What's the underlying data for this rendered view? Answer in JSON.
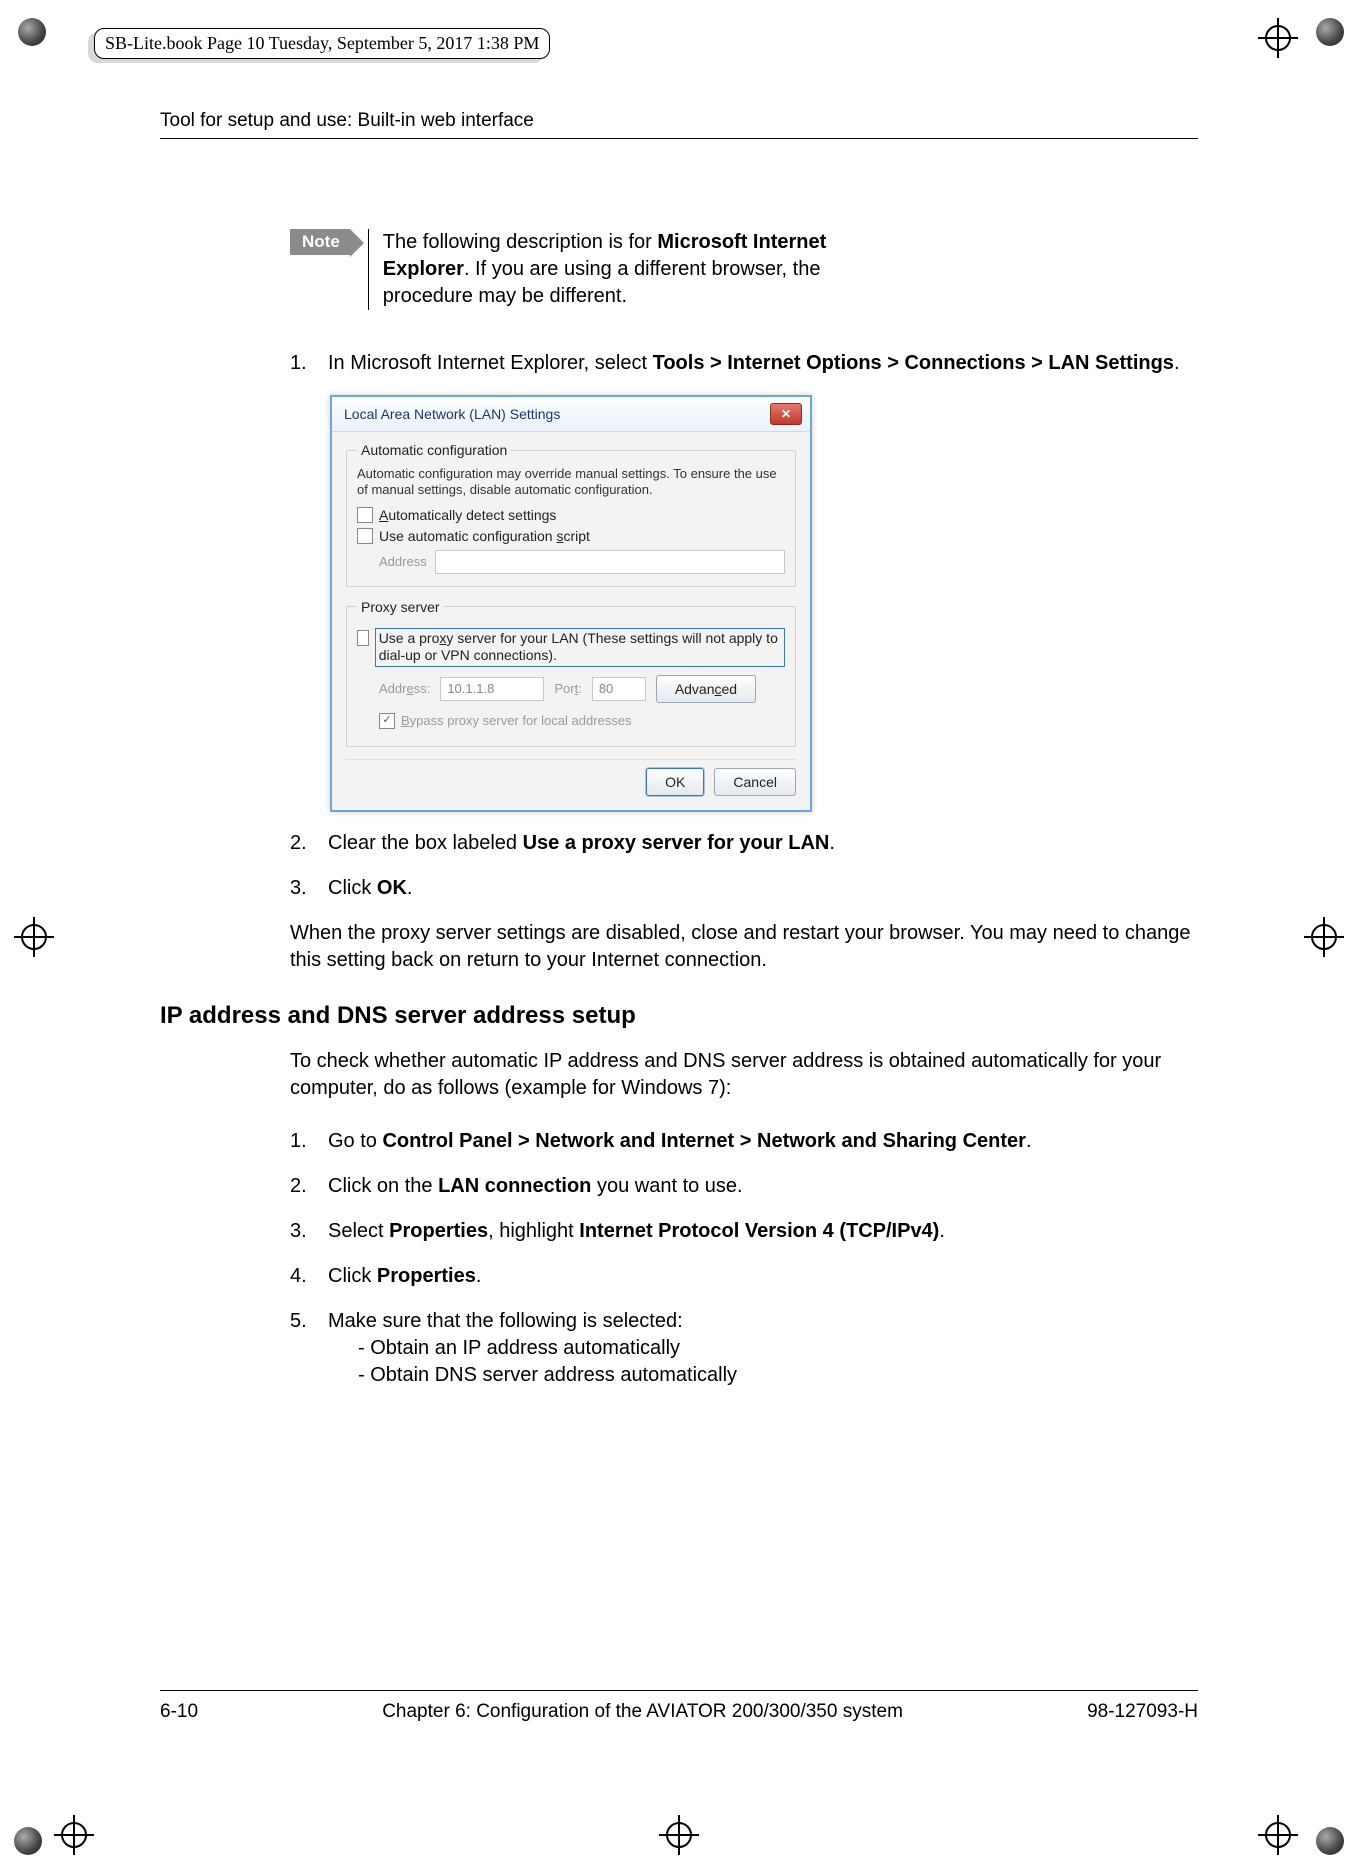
{
  "meta": {
    "print_note": "SB-Lite.book  Page 10  Tuesday, September 5, 2017  1:38 PM"
  },
  "header": {
    "running": "Tool for setup and use: Built-in web interface"
  },
  "note": {
    "badge": "Note",
    "text_prefix": "The following description is for ",
    "text_bold": "Microsoft Internet Explorer",
    "text_suffix": ". If you are using a different browser, the procedure may be different."
  },
  "stepsA": {
    "s1": {
      "num": "1.",
      "pre": "In Microsoft Internet Explorer, select ",
      "bold": "Tools > Internet Options > Connections > LAN Settings",
      "post": "."
    },
    "s2": {
      "num": "2.",
      "pre": "Clear the box labeled ",
      "bold": "Use a proxy server for your LAN",
      "post": "."
    },
    "s3": {
      "num": "3.",
      "pre": "Click ",
      "bold": "OK",
      "post": "."
    }
  },
  "paraA": "When the proxy server settings are disabled, close and restart your browser. You may need to change this setting back on return to your Internet connection.",
  "sectionB": {
    "title": "IP address and DNS server address setup",
    "intro": "To check whether automatic IP address and DNS server address is obtained automatically for your computer, do as follows (example for Windows 7):",
    "s1": {
      "num": "1.",
      "pre": "Go to ",
      "bold": "Control Panel > Network and Internet > Network and Sharing Center",
      "post": "."
    },
    "s2": {
      "num": "2.",
      "pre": "Click on the ",
      "bold": "LAN connection",
      "post": " you want to use."
    },
    "s3": {
      "num": "3.",
      "pre": "Select ",
      "bold1": "Properties",
      "mid": ", highlight ",
      "bold2": "Internet Protocol Version 4 (TCP/IPv4)",
      "post": "."
    },
    "s4": {
      "num": "4.",
      "pre": "Click ",
      "bold": "Properties",
      "post": "."
    },
    "s5": {
      "num": "5.",
      "lead": "Make sure that the following is selected:",
      "b1": "- Obtain an IP address automatically",
      "b2": "- Obtain DNS server address automatically"
    }
  },
  "dialog": {
    "title": "Local Area Network (LAN) Settings",
    "close_glyph": "✕",
    "group_auto": "Automatic configuration",
    "auto_desc": "Automatic configuration may override manual settings.  To ensure the use of manual settings, disable automatic configuration.",
    "chk_detect_pre": "A",
    "chk_detect": "utomatically detect settings",
    "chk_script": "Use automatic configuration ",
    "chk_script_u": "s",
    "chk_script_post": "cript",
    "addr_label": "Address",
    "group_proxy": "Proxy server",
    "chk_proxy_pre": "Use a pro",
    "chk_proxy_u": "x",
    "chk_proxy_post": "y server for your LAN (These settings will not apply to dial-up or VPN connections).",
    "addr2_label": "Addr",
    "addr2_u": "e",
    "addr2_post": "ss:",
    "addr2_value": "10.1.1.8",
    "port_label": "Por",
    "port_u": "t",
    "port_post": ":",
    "port_value": "80",
    "advanced": "Advan",
    "advanced_u": "c",
    "advanced_post": "ed",
    "chk_bypass_pre": "B",
    "chk_bypass": "ypass proxy server for local addresses",
    "ok": "OK",
    "cancel": "Cancel"
  },
  "footer": {
    "pagenum": "6-10",
    "chapter": "Chapter 6:  Configuration of the AVIATOR 200/300/350 system",
    "docnum": "98-127093-H"
  }
}
